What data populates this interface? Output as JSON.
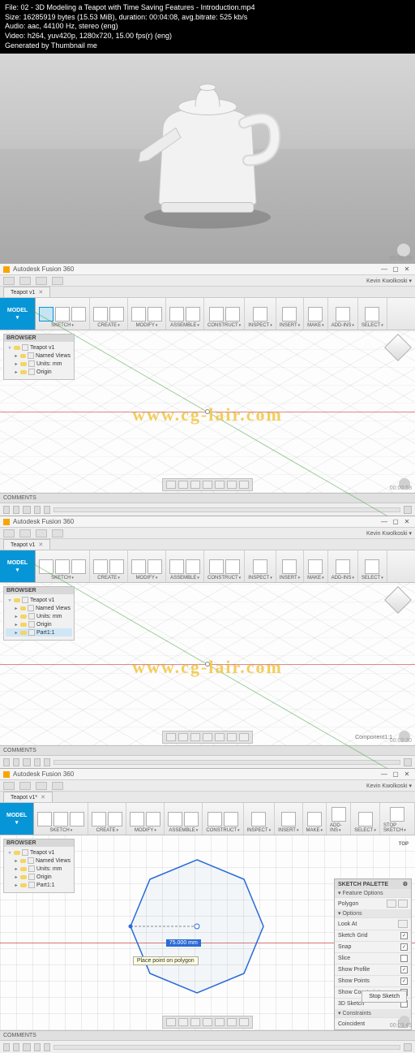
{
  "meta": {
    "file": "File: 02 - 3D Modeling a Teapot with Time Saving Features - Introduction.mp4",
    "size": "Size: 16285919 bytes (15.53 MiB), duration: 00:04:08, avg.bitrate: 525 kb/s",
    "audio": "Audio: aac, 44100 Hz, stereo (eng)",
    "video": "Video: h264, yuv420p, 1280x720, 15.00 fps(r) (eng)",
    "gen": "Generated by Thumbnail me"
  },
  "timestamps": {
    "t1": "00:00:09",
    "t2": "00:00:58",
    "t3": "00:02:30",
    "t4": "00:03:45"
  },
  "app_title": "Autodesk Fusion 360",
  "username": "Kevin Kwolkoski",
  "tab_name": "Teapot v1",
  "tab_name_dirty": "Teapot v1*",
  "model_label": "MODEL",
  "ribbon_groups": [
    "SKETCH",
    "CREATE",
    "MODIFY",
    "ASSEMBLE",
    "CONSTRUCT",
    "INSPECT",
    "INSERT",
    "MAKE",
    "ADD-INS",
    "SELECT"
  ],
  "ribbon_groups_sketch": [
    "SKETCH",
    "CREATE",
    "MODIFY",
    "ASSEMBLE",
    "CONSTRUCT",
    "INSPECT",
    "INSERT",
    "MAKE",
    "ADD-INS",
    "SELECT",
    "STOP SKETCH"
  ],
  "browser_title": "BROWSER",
  "browser1": {
    "root": "Teapot v1",
    "children": [
      "Named Views",
      "Units: mm",
      "Origin"
    ]
  },
  "browser2": {
    "root": "Teapot v1",
    "children": [
      "Named Views",
      "Units: mm",
      "Origin",
      "Part1:1"
    ]
  },
  "browser3": {
    "root": "Teapot v1",
    "children": [
      "Named Views",
      "Units: mm",
      "Origin",
      "Part1:1"
    ]
  },
  "comments_label": "COMMENTS",
  "component_label": "Component1:1",
  "watermark": "www.cg-lair.com",
  "top_label": "TOP",
  "sketch": {
    "dim_value": "75.000 mm",
    "tooltip": "Place point on polygon"
  },
  "palette": {
    "title": "SKETCH PALETTE",
    "section1": "Feature Options",
    "polygon_label": "Polygon",
    "section2": "Options",
    "rows": [
      {
        "label": "Look At",
        "checked": false,
        "icon": true
      },
      {
        "label": "Sketch Grid",
        "checked": true
      },
      {
        "label": "Snap",
        "checked": true
      },
      {
        "label": "Slice",
        "checked": false
      },
      {
        "label": "Show Profile",
        "checked": true
      },
      {
        "label": "Show Points",
        "checked": true
      },
      {
        "label": "Show Constraints",
        "checked": true
      },
      {
        "label": "3D Sketch",
        "checked": false
      }
    ],
    "section3": "Constraints",
    "coincident": "Coincident",
    "stop_sketch": "Stop Sketch"
  }
}
